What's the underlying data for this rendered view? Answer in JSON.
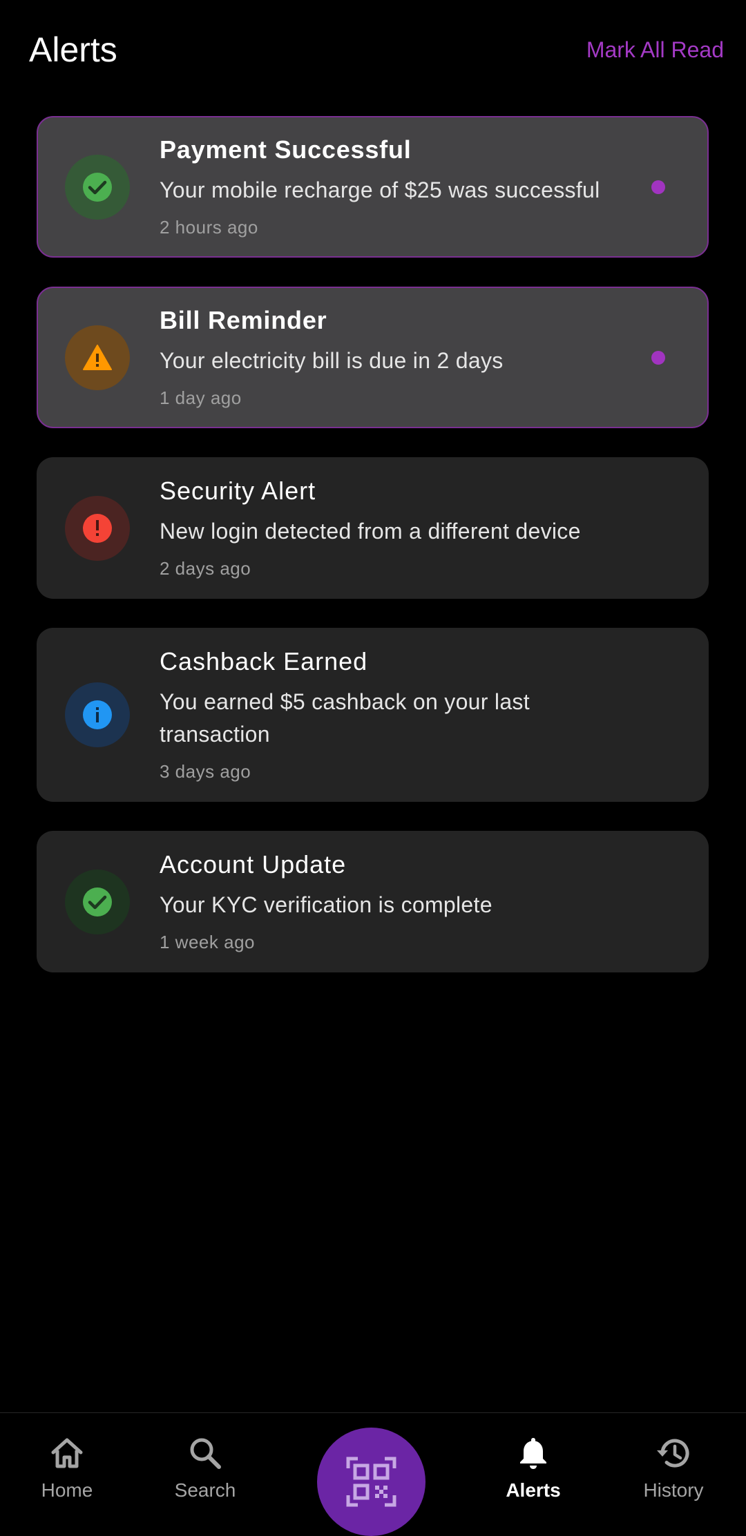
{
  "header": {
    "title": "Alerts",
    "mark_all_read": "Mark All Read"
  },
  "colors": {
    "accent": "#a43ac6",
    "unread_dot": "#a134c0",
    "success": "#4caf50",
    "warning": "#ff9800",
    "error": "#f44336",
    "info": "#2196f3",
    "fab": "#6b25a5"
  },
  "alerts": [
    {
      "title": "Payment Successful",
      "message": "Your mobile recharge of $25 was successful",
      "time": "2 hours ago",
      "icon": "check-circle-icon",
      "unread": true
    },
    {
      "title": "Bill Reminder",
      "message": "Your electricity bill is due in 2 days",
      "time": "1 day ago",
      "icon": "warning-icon",
      "unread": true
    },
    {
      "title": "Security Alert",
      "message": "New login detected from a different device",
      "time": "2 days ago",
      "icon": "error-icon",
      "unread": false
    },
    {
      "title": "Cashback Earned",
      "message": "You earned $5 cashback on your last transaction",
      "time": "3 days ago",
      "icon": "info-icon",
      "unread": false
    },
    {
      "title": "Account Update",
      "message": "Your KYC verification is complete",
      "time": "1 week ago",
      "icon": "check-circle-icon",
      "unread": false
    }
  ],
  "nav": {
    "items": [
      {
        "label": "Home",
        "icon": "home-icon"
      },
      {
        "label": "Search",
        "icon": "search-icon"
      },
      {
        "label": "Alerts",
        "icon": "bell-icon",
        "active": true
      },
      {
        "label": "History",
        "icon": "history-icon"
      }
    ],
    "fab_icon": "qr-scan-icon"
  }
}
